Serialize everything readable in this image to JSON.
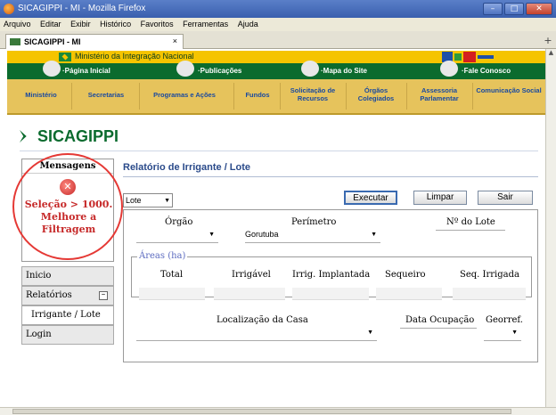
{
  "window": {
    "title": "SICAGIPPI - MI - Mozilla Firefox",
    "controls": [
      "–",
      "□",
      "✕"
    ]
  },
  "menu": [
    "Arquivo",
    "Editar",
    "Exibir",
    "Histórico",
    "Favoritos",
    "Ferramentas",
    "Ajuda"
  ],
  "tab": {
    "label": "SICAGIPPI - MI",
    "close": "×"
  },
  "gov": {
    "ministry": "Ministério da Integração Nacional"
  },
  "toplinks": [
    "·Página Inicial",
    "·Publicações",
    "·Mapa do Site",
    "·Fale Conosco"
  ],
  "nav": [
    {
      "label": "Ministério"
    },
    {
      "label": "Secretarias"
    },
    {
      "label": "Programas e Ações"
    },
    {
      "label": "Fundos"
    },
    {
      "label": "Solicitação de Recursos"
    },
    {
      "label": "Órgãos Colegiados"
    },
    {
      "label": "Assessoria Parlamentar"
    },
    {
      "label": "Comunicação Social"
    }
  ],
  "app": {
    "title": "SICAGIPPI"
  },
  "messages": {
    "title": "Mensagens",
    "error": "Seleção > 1000. Melhore a Filtragem"
  },
  "sidemenu": [
    {
      "label": "Inicio"
    },
    {
      "label": "Relatórios",
      "toggle": "–"
    },
    {
      "label": "Irrigante / Lote"
    },
    {
      "label": "Login"
    }
  ],
  "report": {
    "title": "Relatório de Irrigante / Lote",
    "type_select": "Lote",
    "buttons": {
      "executar": "Executar",
      "limpar": "Limpar",
      "sair": "Sair"
    },
    "labels": {
      "orgao": "Órgão",
      "perimetro": "Perímetro",
      "perimetro_value": "Gorutuba",
      "lote_no": "Nº do Lote",
      "areas": "Áreas (ha)",
      "total": "Total",
      "irrigavel": "Irrigável",
      "irrig_implantada": "Irrig. Implantada",
      "sequeiro": "Sequeiro",
      "seq_irrigada": "Seq. Irrigada",
      "localizacao": "Localização da Casa",
      "data_ocupacao": "Data Ocupação",
      "georref": "Georref."
    }
  }
}
